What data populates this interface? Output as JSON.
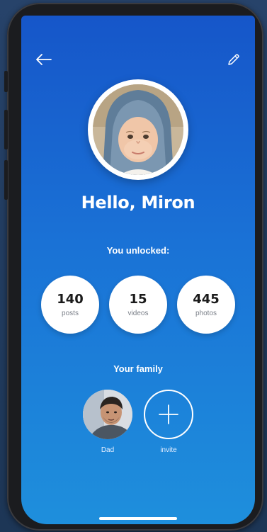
{
  "header": {
    "back_icon": "back-arrow-icon",
    "edit_icon": "pencil-icon"
  },
  "profile": {
    "greeting": "Hello, Miron",
    "avatar": "child-photo"
  },
  "unlocked": {
    "label": "You unlocked:",
    "stats": [
      {
        "value": "140",
        "label": "posts"
      },
      {
        "value": "15",
        "label": "videos"
      },
      {
        "value": "445",
        "label": "photos"
      }
    ]
  },
  "family": {
    "label": "Your family",
    "members": [
      {
        "name": "Dad",
        "avatar": "dad-photo"
      }
    ],
    "invite_label": "invite",
    "invite_icon": "plus-icon"
  },
  "colors": {
    "gradient_top": "#1656c9",
    "gradient_bottom": "#1e8fdc",
    "card": "#ffffff"
  }
}
